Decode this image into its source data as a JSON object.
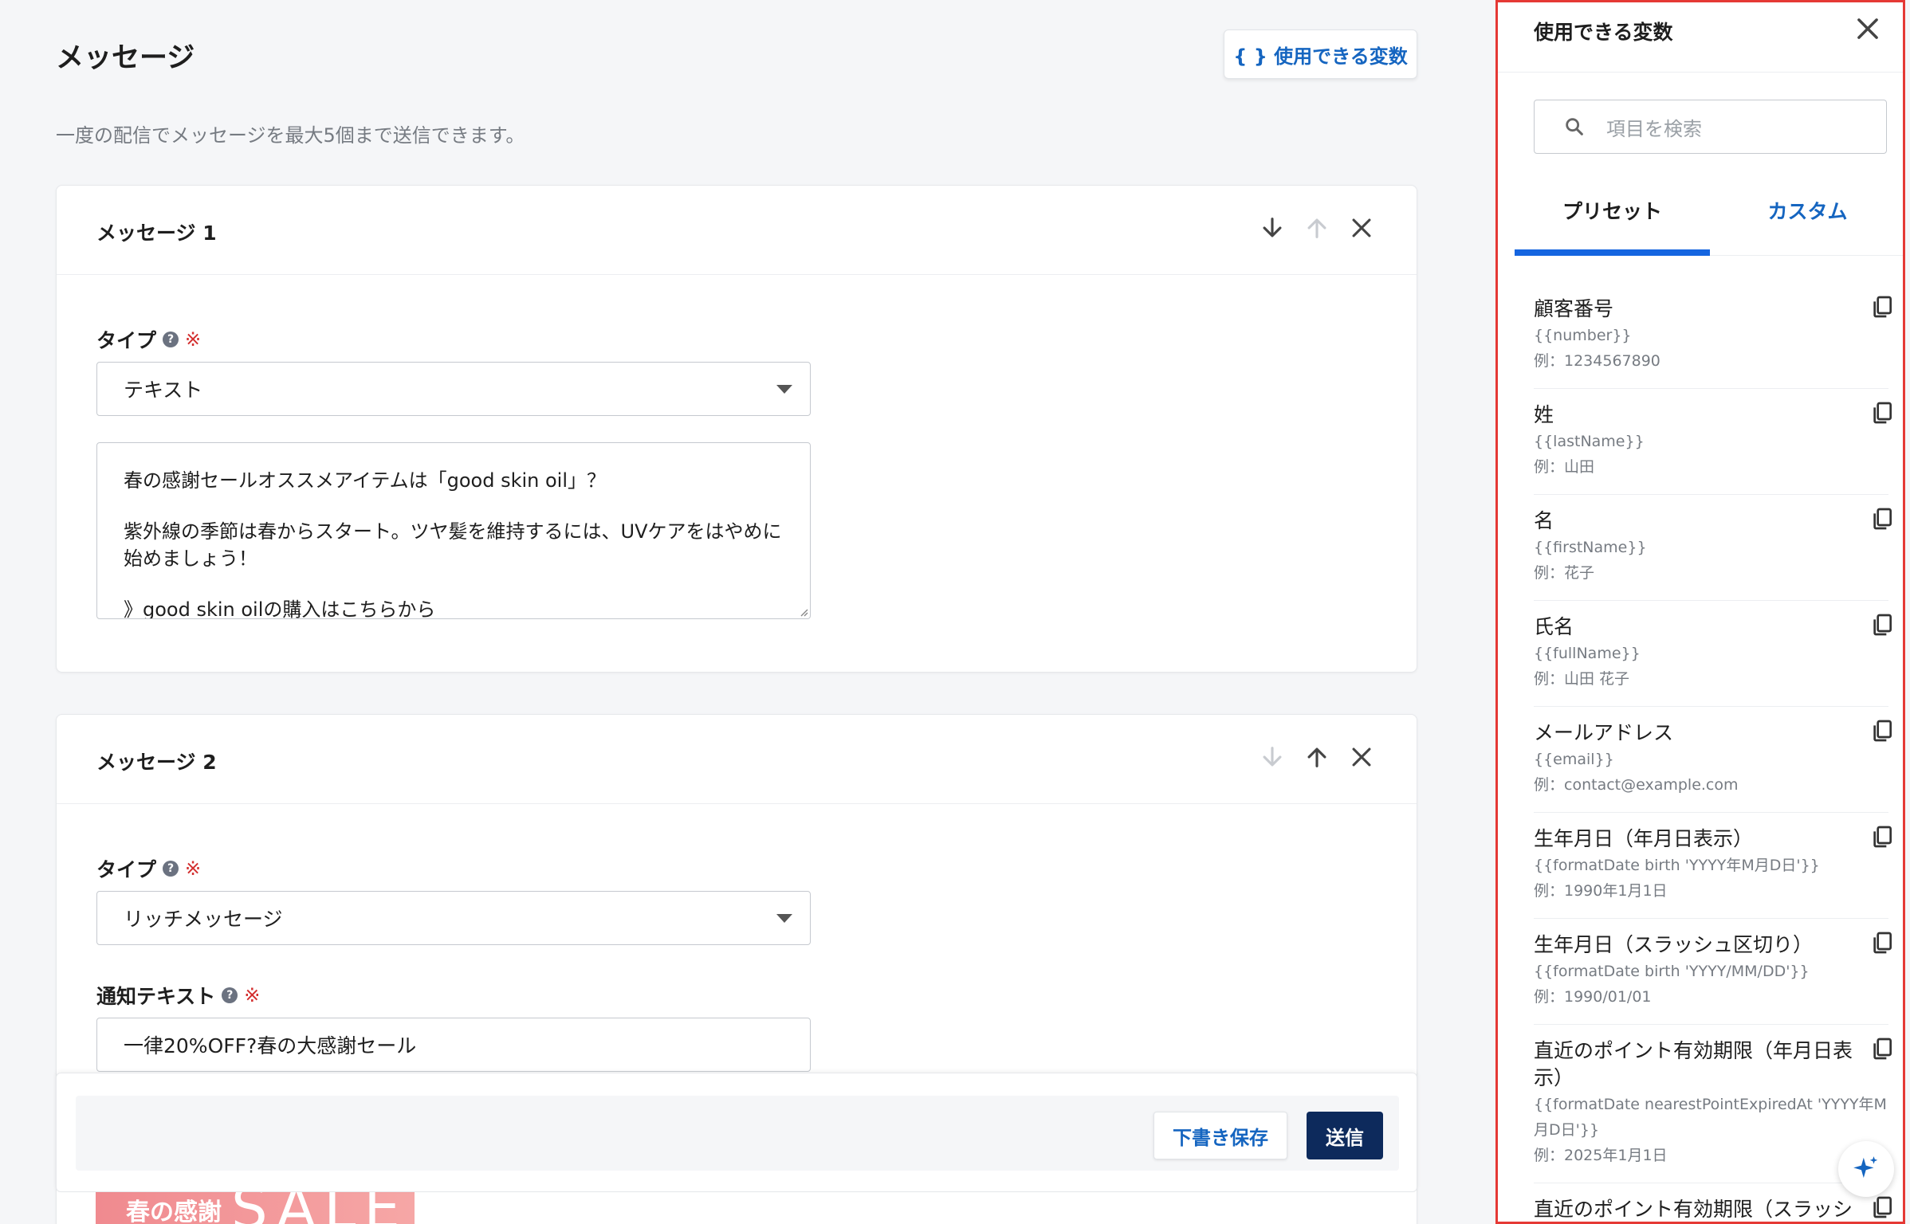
{
  "page": {
    "title": "メッセージ",
    "subtitle": "一度の配信でメッセージを最大5個まで送信できます。",
    "vars_button_label": "{ } 使用できる変数"
  },
  "message1": {
    "title": "メッセージ 1",
    "type_label": "タイプ",
    "required_mark": "※",
    "type_value": "テキスト",
    "body_lines": [
      "春の感謝セールオススメアイテムは「good skin oil」？",
      "",
      "紫外線の季節は春からスタート。ツヤ髪を維持するには、UVケアをはやめに始めましょう！",
      "",
      "》good skin oilの購入はこちらから"
    ]
  },
  "message2": {
    "title": "メッセージ 2",
    "type_label": "タイプ",
    "required_mark": "※",
    "type_value": "リッチメッセージ",
    "notify_label": "通知テキスト",
    "notify_value": "一律20%OFF?春の大感謝セール",
    "banner_text_small": "春の感謝",
    "banner_text_big": "SALE"
  },
  "footer": {
    "draft_label": "下書き保存",
    "send_label": "送信"
  },
  "panel": {
    "title": "使用できる変数",
    "search_placeholder": "項目を検索",
    "tabs": [
      {
        "label": "プリセット",
        "active": true
      },
      {
        "label": "カスタム",
        "active": false
      }
    ],
    "variables": [
      {
        "name": "顧客番号",
        "code": "{{number}}",
        "example": "例：1234567890"
      },
      {
        "name": "姓",
        "code": "{{lastName}}",
        "example": "例：山田"
      },
      {
        "name": "名",
        "code": "{{firstName}}",
        "example": "例：花子"
      },
      {
        "name": "氏名",
        "code": "{{fullName}}",
        "example": "例：山田 花子"
      },
      {
        "name": "メールアドレス",
        "code": "{{email}}",
        "example": "例：contact@example.com"
      },
      {
        "name": "生年月日（年月日表示）",
        "code": "{{formatDate birth 'YYYY年M月D日'}}",
        "example": "例：1990年1月1日"
      },
      {
        "name": "生年月日（スラッシュ区切り）",
        "code": "{{formatDate birth 'YYYY/MM/DD'}}",
        "example": "例：1990/01/01"
      },
      {
        "name": "直近のポイント有効期限（年月日表示）",
        "code": "{{formatDate nearestPointExpiredAt 'YYYY年M月D日'}}",
        "example": "例：2025年1月1日"
      },
      {
        "name": "直近のポイント有効期限（スラッシュ区切り）",
        "code": "",
        "example": ""
      }
    ]
  },
  "colors": {
    "accent": "#1565c0",
    "primary_button": "#0d2a5c",
    "required": "#d32f2f",
    "panel_border": "#e53935"
  }
}
